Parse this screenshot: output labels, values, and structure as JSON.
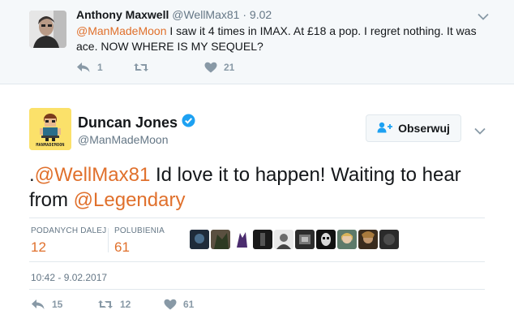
{
  "reply_tweet": {
    "author_name": "Anthony Maxwell",
    "author_handle": "@WellMax81",
    "dot": "·",
    "time": "9.02",
    "mention": "@ManMadeMoon",
    "text": " I saw it 4 times in IMAX. At £18 a pop. I regret nothing. It was ace. NOW WHERE IS MY SEQUEL?",
    "replies": "1",
    "retweets": "",
    "likes": "21"
  },
  "main_tweet": {
    "author_name": "Duncan Jones",
    "author_handle": "@ManMadeMoon",
    "avatar_label": "MANMADEMOON",
    "follow_label": "Obserwuj",
    "text_prefix": ".",
    "mention_1": "@WellMax81",
    "text_middle": " Id love it to happen!  Waiting to hear from ",
    "mention_2": "@Legendary",
    "stats": [
      {
        "label": "PODANYCH DALEJ",
        "value": "12"
      },
      {
        "label": "POLUBIENIA",
        "value": "61"
      }
    ],
    "timestamp": "10:42 - 9.02.2017",
    "replies": "15",
    "retweets": "12",
    "likes": "61"
  },
  "colors": {
    "link": "#e0702c",
    "muted": "#657786",
    "icon": "#8899a6",
    "verified": "#1da1f2"
  },
  "icons": [
    "reply-icon",
    "retweet-icon",
    "heart-icon",
    "chevron-down-icon",
    "verified-badge-icon",
    "follow-person-icon"
  ]
}
